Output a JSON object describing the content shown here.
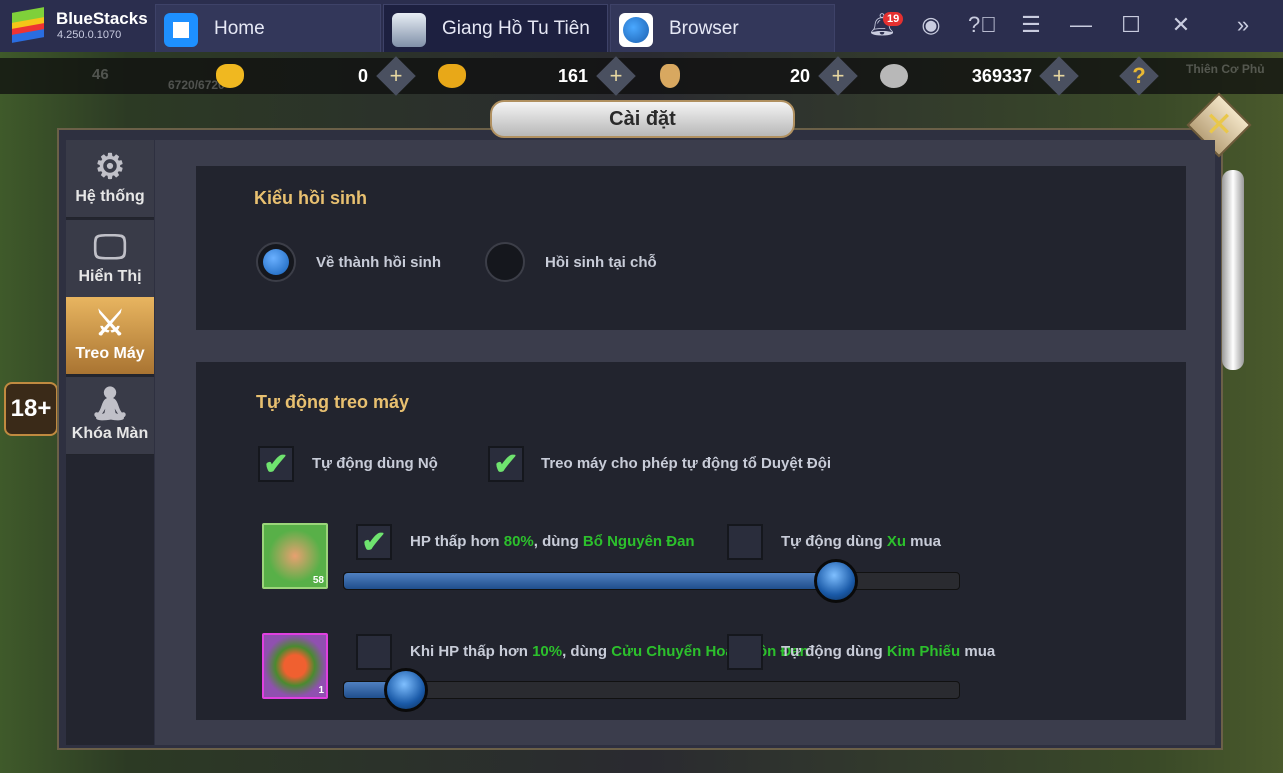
{
  "app": {
    "name": "BlueStacks",
    "version": "4.250.0.1070"
  },
  "tabs": [
    {
      "label": "Home",
      "icon": "home-icon"
    },
    {
      "label": "Giang Hồ Tu Tiên",
      "icon": "game-icon",
      "active": true
    },
    {
      "label": "Browser",
      "icon": "globe-icon"
    }
  ],
  "titlebar": {
    "notifications": "19"
  },
  "hud": {
    "level": "46",
    "hp": "6720/6720",
    "location": "Thiên Cơ Phủ",
    "age_rating": "18+"
  },
  "resources": [
    {
      "icon": "gold-ingot-icon",
      "value": "0"
    },
    {
      "icon": "bound-gold-icon",
      "value": "161"
    },
    {
      "icon": "scroll-icon",
      "value": "20"
    },
    {
      "icon": "silver-coin-icon",
      "value": "369337"
    }
  ],
  "dialog": {
    "title": "Cài đặt",
    "sidebar": [
      {
        "label": "Hệ thống",
        "icon": "gear-icon"
      },
      {
        "label": "Hiển Thị",
        "icon": "monitor-icon"
      },
      {
        "label": "Treo Máy",
        "icon": "crossed-swords-icon",
        "active": true
      },
      {
        "label": "Khóa Màn",
        "icon": "meditation-icon"
      }
    ],
    "revive": {
      "title": "Kiểu hồi sinh",
      "options": [
        {
          "label": "Về thành hồi sinh",
          "selected": true
        },
        {
          "label": "Hồi sinh tại chỗ",
          "selected": false
        }
      ]
    },
    "auto": {
      "title": "Tự động treo máy",
      "checks": [
        {
          "label": "Tự động dùng Nộ",
          "checked": true
        },
        {
          "label": "Treo máy cho phép tự động tổ Duyệt Đội",
          "checked": true
        }
      ],
      "potions": [
        {
          "count": "58",
          "checked": true,
          "pre": "HP thấp hơn ",
          "pct": "80%",
          "mid": ", dùng ",
          "name": "Bổ Nguyên Đan",
          "buy_pre": "Tự động dùng ",
          "buy_cur": "Xu",
          "buy_post": " mua",
          "buy_checked": false,
          "slider_percent": 80
        },
        {
          "count": "1",
          "checked": false,
          "pre": "Khi HP thấp hơn ",
          "pct": "10%",
          "mid": ", dùng ",
          "name": "Cửu Chuyển Hoàn Hồn Đan",
          "buy_pre": "Tự động dùng ",
          "buy_cur": "Kim Phiếu",
          "buy_post": " mua",
          "buy_checked": false,
          "slider_percent": 10
        }
      ]
    }
  }
}
